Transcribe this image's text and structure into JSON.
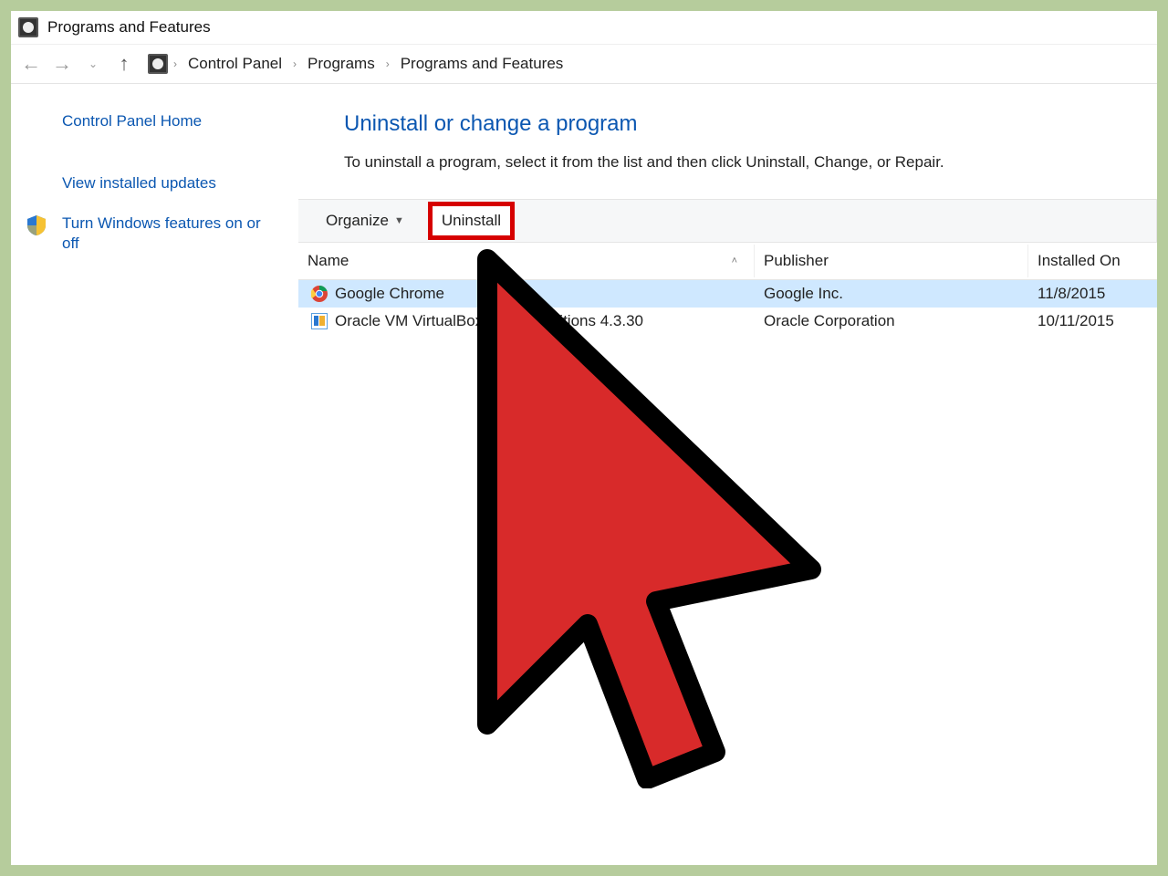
{
  "window_title": "Programs and Features",
  "breadcrumb": {
    "items": [
      "Control Panel",
      "Programs",
      "Programs and Features"
    ]
  },
  "sidebar": {
    "home": "Control Panel Home",
    "updates": "View installed updates",
    "features": "Turn Windows features on or off"
  },
  "main": {
    "heading": "Uninstall or change a program",
    "description": "To uninstall a program, select it from the list and then click Uninstall, Change, or Repair."
  },
  "toolbar": {
    "organize": "Organize",
    "uninstall": "Uninstall"
  },
  "columns": {
    "name": "Name",
    "publisher": "Publisher",
    "installed_on": "Installed On"
  },
  "programs": [
    {
      "name": "Google Chrome",
      "publisher": "Google Inc.",
      "installed_on": "11/8/2015",
      "selected": true,
      "icon": "chrome-icon"
    },
    {
      "name": "Oracle VM VirtualBox Guest Additions 4.3.30",
      "publisher": "Oracle Corporation",
      "installed_on": "10/11/2015",
      "selected": false,
      "icon": "vbox-icon"
    }
  ],
  "annotation": {
    "highlight": "Uninstall button highlighted with red rectangle",
    "cursor": "Large red cursor arrow pointing at Uninstall"
  }
}
